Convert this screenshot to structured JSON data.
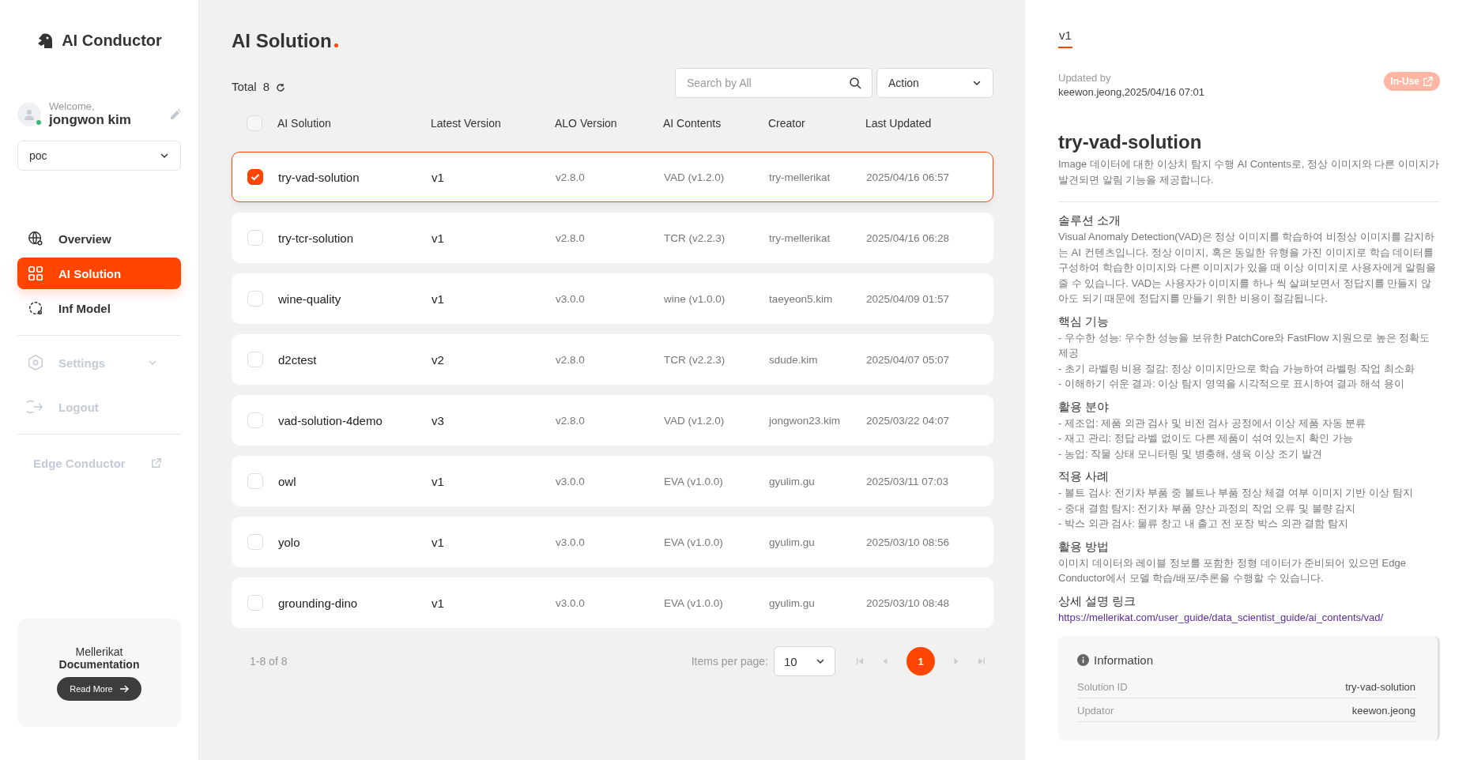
{
  "sidebar": {
    "logo": "AI Conductor",
    "user": {
      "greeting": "Welcome,",
      "name": "jongwon kim",
      "online": true
    },
    "workspace": {
      "value": "poc"
    },
    "nav": [
      {
        "label": "Overview",
        "selected": false,
        "disabled": false
      },
      {
        "label": "AI Solution",
        "selected": true,
        "disabled": false
      },
      {
        "label": "Inf Model",
        "selected": false,
        "disabled": false
      }
    ],
    "secondary_nav": [
      {
        "label": "Settings",
        "disabled": true,
        "expanded": false,
        "kind": "menu"
      },
      {
        "label": "Logout",
        "disabled": true,
        "kind": "action"
      }
    ],
    "external_link": {
      "label": "Edge Conductor",
      "disabled": true
    },
    "doc_card": {
      "line1": "Mellerikat",
      "line2": "Documentation",
      "button": "Read More"
    }
  },
  "main": {
    "title": "AI Solution",
    "total_label": "Total",
    "total_count": "8",
    "search": {
      "placeholder": "Search by All"
    },
    "action": {
      "value": "Action"
    },
    "columns": [
      "AI Solution",
      "Latest Version",
      "ALO Version",
      "AI Contents",
      "Creator",
      "Last Updated"
    ],
    "header_checked": false,
    "rows": [
      {
        "selected": true,
        "name": "try-vad-solution",
        "latest": "v1",
        "alo": "v2.8.0",
        "contents": "VAD (v1.2.0)",
        "creator": "try-mellerikat",
        "updated": "2025/04/16 06:57"
      },
      {
        "selected": false,
        "name": "try-tcr-solution",
        "latest": "v1",
        "alo": "v2.8.0",
        "contents": "TCR (v2.2.3)",
        "creator": "try-mellerikat",
        "updated": "2025/04/16 06:28"
      },
      {
        "selected": false,
        "name": "wine-quality",
        "latest": "v1",
        "alo": "v3.0.0",
        "contents": "wine (v1.0.0)",
        "creator": "taeyeon5.kim",
        "updated": "2025/04/09 01:57"
      },
      {
        "selected": false,
        "name": "d2ctest",
        "latest": "v2",
        "alo": "v2.8.0",
        "contents": "TCR (v2.2.3)",
        "creator": "sdude.kim",
        "updated": "2025/04/07 05:07"
      },
      {
        "selected": false,
        "name": "vad-solution-4demo",
        "latest": "v3",
        "alo": "v2.8.0",
        "contents": "VAD (v1.2.0)",
        "creator": "jongwon23.kim",
        "updated": "2025/03/22 04:07"
      },
      {
        "selected": false,
        "name": "owl",
        "latest": "v1",
        "alo": "v3.0.0",
        "contents": "EVA (v1.0.0)",
        "creator": "gyulim.gu",
        "updated": "2025/03/11 07:03"
      },
      {
        "selected": false,
        "name": "yolo",
        "latest": "v1",
        "alo": "v3.0.0",
        "contents": "EVA (v1.0.0)",
        "creator": "gyulim.gu",
        "updated": "2025/03/10 08:56"
      },
      {
        "selected": false,
        "name": "grounding-dino",
        "latest": "v1",
        "alo": "v3.0.0",
        "contents": "EVA (v1.0.0)",
        "creator": "gyulim.gu",
        "updated": "2025/03/10 08:48"
      }
    ],
    "pagination": {
      "range": "1-8 of 8",
      "items_label": "Items per page:",
      "per_page": "10",
      "pages": [
        {
          "label": "1",
          "selected": true
        }
      ]
    }
  },
  "detail": {
    "tabs": [
      {
        "label": "v1",
        "selected": true
      }
    ],
    "updated_label": "Updated by",
    "updated_value": "keewon.jeong,2025/04/16 07:01",
    "badge": "In-Use",
    "title": "try-vad-solution",
    "description": "Image 데이터에 대한 이상치 탐지 수행 AI Contents로, 정상 이미지와 다른 이미지가 발견되면 알림 기능을 제공합니다.",
    "sections": [
      {
        "kind": "text",
        "heading": "솔루션 소개",
        "lines": [
          "Visual Anomaly Detection(VAD)은 정상 이미지를 학습하여 비정상 이미지를 감지하는 AI 컨텐츠입니다. 정상 이미지, 혹은 동일한 유형을 가진 이미지로 학습 데이터를 구성하여 학습한 이미지와 다른 이미지가 있을 때 이상 이미지로 사용자에게 알림을 줄 수 있습니다. VAD는 사용자가 이미지를 하나 씩 살펴보면서 정답지를 만들지 않아도 되기 때문에 정답지를 만들기 위한 비용이 절감됩니다."
        ]
      },
      {
        "kind": "text",
        "heading": "핵심 기능",
        "lines": [
          "- 우수한 성능: 우수한 성능을 보유한 PatchCore와 FastFlow 지원으로 높은 정확도 제공",
          "- 초기 라벨링 비용 절감: 정상 이미지만으로 학습 가능하여 라벨링 작업 최소화",
          "- 이해하기 쉬운 결과: 이상 탐지 영역을 시각적으로 표시하여 결과 해석 용이"
        ]
      },
      {
        "kind": "text",
        "heading": "활용 분야",
        "lines": [
          "- 제조업: 제품 외관 검사 및 비전 검사 공정에서 이상 제품 자동 분류",
          "- 재고 관리: 정답 라벨 없이도 다른 제품이 섞여 있는지 확인 가능",
          "- 농업: 작물 상태 모니터링 및 병충해, 생육 이상 조기 발견"
        ]
      },
      {
        "kind": "text",
        "heading": "적용 사례",
        "lines": [
          "- 볼트 검사: 전기차 부품 중 볼트나 부품 정상 체결 여부 이미지 기반 이상 탐지",
          "- 중대 결함 탐지: 전기차 부품 양산 과정의 작업 오류 및 불량 감지",
          "- 박스 외관 검사: 물류 창고 내 출고 전 포장 박스 외관 결함 탐지"
        ]
      },
      {
        "kind": "text",
        "heading": "활용 방법",
        "lines": [
          "이미지 데이터와 레이블 정보를 포함한 정형 데이터가 준비되어 있으면 Edge Conductor에서 모델 학습/배포/추론을 수행할 수 있습니다."
        ]
      },
      {
        "kind": "link",
        "heading": "상세 설명 링크",
        "lines": [
          "https://mellerikat.com/user_guide/data_scientist_guide/ai_contents/vad/"
        ]
      }
    ],
    "info": {
      "title": "Information",
      "rows": [
        {
          "label": "Solution ID",
          "value": "try-vad-solution"
        },
        {
          "label": "Updator",
          "value": "keewon.jeong"
        }
      ]
    }
  }
}
